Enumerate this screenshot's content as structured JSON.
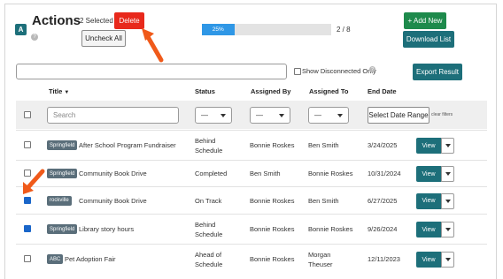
{
  "header": {
    "logo_letter": "A",
    "title": "Actions",
    "help_icon": "question-circle-icon",
    "selected_count": "2 Selected",
    "delete_label": "Delete",
    "uncheck_all_label": "Uncheck All",
    "progress_percent_label": "25%",
    "progress_value": 0.25,
    "progress_count": "2 / 8",
    "add_new_label": "+ Add New",
    "download_list_label": "Download List"
  },
  "toolbar": {
    "search_value": "",
    "show_disconnected_label": "Show Disconnected Only",
    "info_icon": "question-circle-icon",
    "export_label": "Export Result"
  },
  "table": {
    "columns": [
      "Title",
      "Status",
      "Assigned By",
      "Assigned To",
      "End Date"
    ],
    "sort_icon": "caret-down-icon",
    "filters": {
      "search_placeholder": "Search",
      "status_value": "—",
      "assigned_by_value": "—",
      "assigned_to_value": "—",
      "date_range_label": "Select Date Range",
      "clear_filters_label": "clear filters"
    },
    "rows": [
      {
        "checked": false,
        "tag": "Springfield",
        "title": "After School Program Fundraiser",
        "status_line1": "Behind",
        "status_line2": "Schedule",
        "assigned_by": "Bonnie Roskes",
        "assigned_to_line1": "Ben Smith",
        "assigned_to_line2": "",
        "end_date": "3/24/2025",
        "view_label": "View"
      },
      {
        "checked": false,
        "tag": "Springfield",
        "title": "Community Book Drive",
        "status_line1": "Completed",
        "status_line2": "",
        "assigned_by": "Ben Smith",
        "assigned_to_line1": "Bonnie Roskes",
        "assigned_to_line2": "",
        "end_date": "10/31/2024",
        "view_label": "View"
      },
      {
        "checked": true,
        "tag": "rockville",
        "title": "Community Book Drive",
        "status_line1": "On Track",
        "status_line2": "",
        "assigned_by": "Bonnie Roskes",
        "assigned_to_line1": "Ben Smith",
        "assigned_to_line2": "",
        "end_date": "6/27/2025",
        "view_label": "View"
      },
      {
        "checked": true,
        "tag": "Springfield",
        "title": "Library story hours",
        "status_line1": "Behind",
        "status_line2": "Schedule",
        "assigned_by": "Bonnie Roskes",
        "assigned_to_line1": "Bonnie Roskes",
        "assigned_to_line2": "",
        "end_date": "9/26/2024",
        "view_label": "View"
      },
      {
        "checked": false,
        "tag": "ABC",
        "title": "Pet Adoption Fair",
        "status_line1": "Ahead of",
        "status_line2": "Schedule",
        "assigned_by": "Bonnie Roskes",
        "assigned_to_line1": "Morgan",
        "assigned_to_line2": "Theuser",
        "end_date": "12/11/2023",
        "view_label": "View"
      }
    ]
  },
  "colors": {
    "accent_teal": "#1d6f7a",
    "delete_red": "#e8291c",
    "add_green": "#1e8a4c",
    "progress_blue": "#2f97e6",
    "annotation_arrow": "#f05a1a"
  }
}
